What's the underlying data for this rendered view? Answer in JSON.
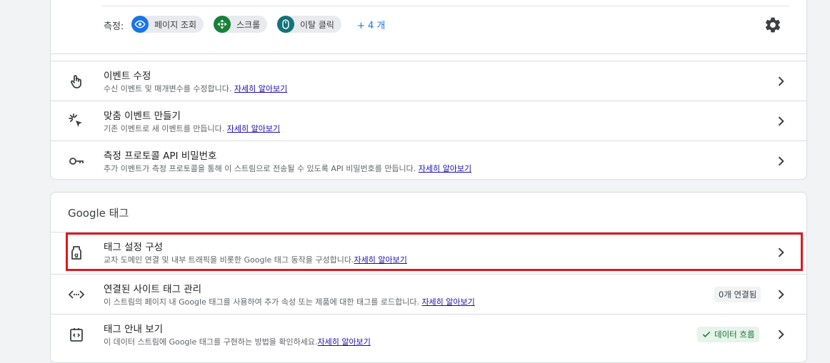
{
  "measurement": {
    "label": "측정:",
    "chips": [
      {
        "label": "페이지 조회",
        "icon": "eye-icon"
      },
      {
        "label": "스크롤",
        "icon": "scroll-arrows-icon"
      },
      {
        "label": "이탈 클릭",
        "icon": "mouse-icon"
      }
    ],
    "more": "+ 4 개",
    "settings_icon": "gear-icon"
  },
  "events_card": {
    "rows": [
      {
        "title": "이벤트 수정",
        "desc": "수신 이벤트 및 매개변수를 수정합니다. ",
        "link": "자세히 알아보기",
        "icon": "touch-hand-icon"
      },
      {
        "title": "맞춤 이벤트 만들기",
        "desc": "기존 이벤트로 새 이벤트를 만듭니다. ",
        "link": "자세히 알아보기",
        "icon": "sparkle-cursor-icon"
      },
      {
        "title": "측정 프로토콜 API 비밀번호",
        "desc": "추가 이벤트가 측정 프로토콜을 통해 이 스트림으로 전송될 수 있도록 API 비밀번호를 만듭니다. ",
        "link": "자세히 알아보기",
        "icon": "key-icon"
      }
    ]
  },
  "google_tag_card": {
    "heading": "Google 태그",
    "rows": [
      {
        "title": "태그 설정 구성",
        "desc": "교차 도메인 연결 및 내부 트래픽을 비롯한 Google 태그 동작을 구성합니다.",
        "link": "자세히 알아보기",
        "icon": "tag-icon"
      },
      {
        "title": "연결된 사이트 태그 관리",
        "desc": "이 스트림의 페이지 내 Google 태그를 사용하여 추가 속성 또는 제품에 대한 태그를 로드합니다. ",
        "link": "자세히 알아보기",
        "icon": "code-arrows-icon",
        "badge": "0개 연결됨"
      },
      {
        "title": "태그 안내 보기",
        "desc": "이 데이터 스트림에 Google 태그를 구현하는 방법을 확인하세요.",
        "link": "자세히 알아보기",
        "icon": "code-box-icon",
        "badge": "데이터 흐름"
      }
    ]
  },
  "colors": {
    "highlight": "#e0161e",
    "chip_eye": "#1a73e8",
    "chip_scroll": "#188038",
    "chip_mouse": "#12737a",
    "link": "#1a73e8",
    "success": "#137333"
  }
}
